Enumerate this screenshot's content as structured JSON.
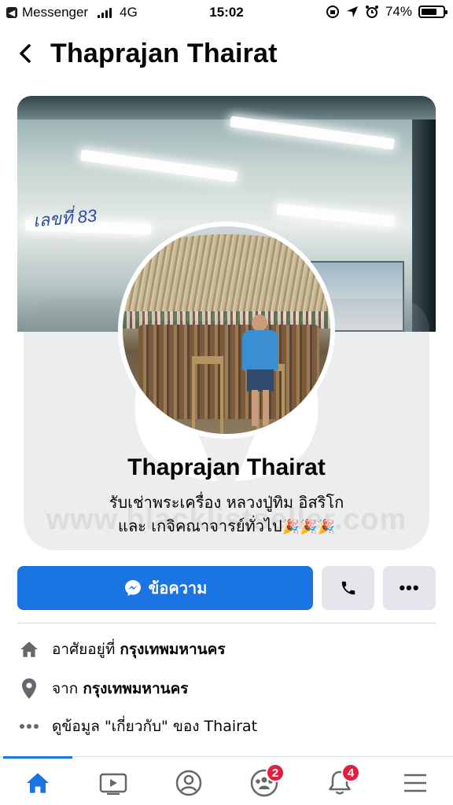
{
  "status_bar": {
    "back_app": "Messenger",
    "network": "4G",
    "time": "15:02",
    "battery": "74%",
    "battery_level": 0.74
  },
  "header": {
    "title": "Thaprajan Thairat"
  },
  "cover": {
    "sign_text": "เลขที่ 83"
  },
  "profile": {
    "name": "Thaprajan Thairat",
    "bio_line1": "รับเช่าพระเครื่อง หลวงปู่ทิม อิสริโก",
    "bio_line2": "และ เกจิคณาจารย์ทั่วไป",
    "bio_emoji": "🎉🎉🎉"
  },
  "watermark": {
    "text": "www.blacklistseller.com"
  },
  "actions": {
    "message_label": "ข้อความ",
    "call_icon": "phone-icon",
    "more_label": "•••"
  },
  "info": {
    "lives_prefix": "อาศัยอยู่ที่",
    "lives_value": "กรุงเทพมหานคร",
    "from_prefix": "จาก",
    "from_value": "กรุงเทพมหานคร",
    "about_text": "ดูข้อมูล \"เกี่ยวกับ\" ของ Thairat"
  },
  "bottom_nav": {
    "items": [
      {
        "icon": "home-icon",
        "active": true
      },
      {
        "icon": "watch-icon"
      },
      {
        "icon": "profile-icon"
      },
      {
        "icon": "groups-icon",
        "badge": "2"
      },
      {
        "icon": "notifications-icon",
        "badge": "4"
      },
      {
        "icon": "menu-icon"
      }
    ]
  },
  "colors": {
    "accent": "#1b74e4",
    "button_gray": "#e4e6eb",
    "badge": "#e41e3f"
  }
}
